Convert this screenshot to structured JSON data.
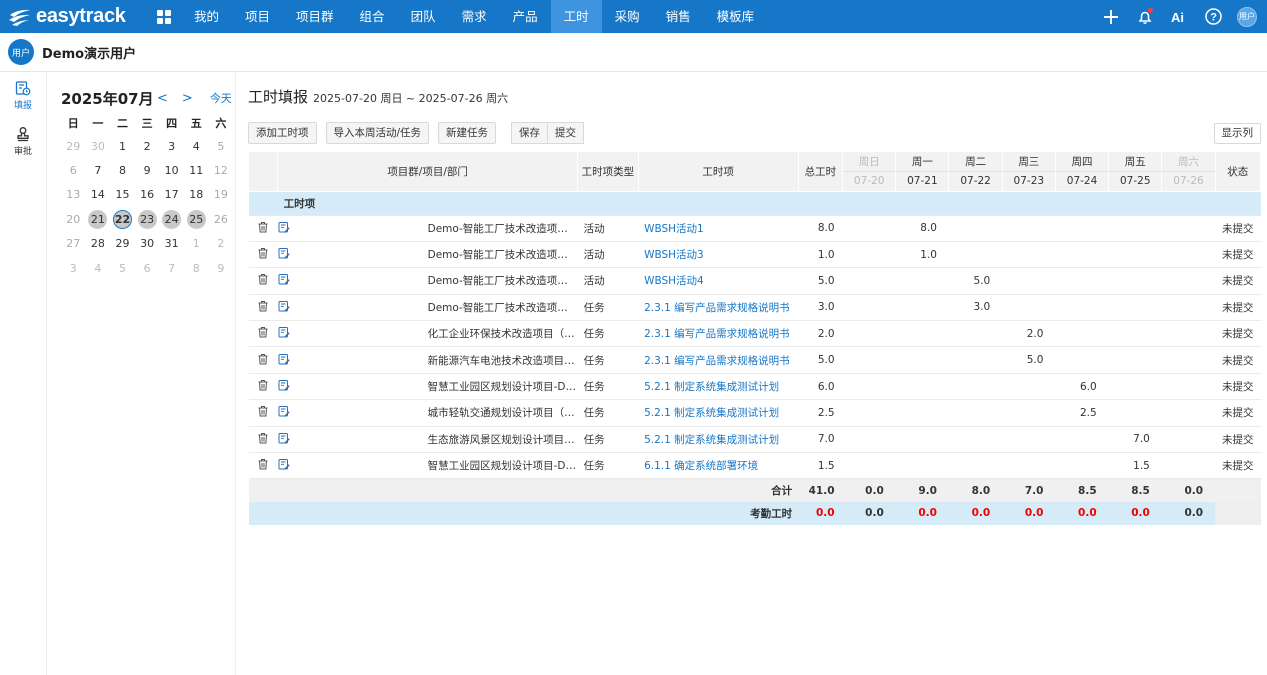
{
  "nav": {
    "logo_text": "easytrack",
    "items": [
      "我的",
      "项目",
      "项目群",
      "组合",
      "团队",
      "需求",
      "产品",
      "工时",
      "采购",
      "销售",
      "模板库"
    ],
    "active": "工时",
    "avatar_text": "用户"
  },
  "user": {
    "avatar_text": "用户",
    "name": "Demo演示用户"
  },
  "sidebar": {
    "items": [
      {
        "label": "填报"
      },
      {
        "label": "审批"
      }
    ]
  },
  "calendar": {
    "title": "2025年07月",
    "prev": "<",
    "next": ">",
    "today": "今天",
    "weekdays": [
      "日",
      "一",
      "二",
      "三",
      "四",
      "五",
      "六"
    ],
    "weeks": [
      [
        "29",
        "30",
        "1",
        "2",
        "3",
        "4",
        "5"
      ],
      [
        "6",
        "7",
        "8",
        "9",
        "10",
        "11",
        "12"
      ],
      [
        "13",
        "14",
        "15",
        "16",
        "17",
        "18",
        "19"
      ],
      [
        "20",
        "21",
        "22",
        "23",
        "24",
        "25",
        "26"
      ],
      [
        "27",
        "28",
        "29",
        "30",
        "31",
        "1",
        "2"
      ],
      [
        "3",
        "4",
        "5",
        "6",
        "7",
        "8",
        "9"
      ]
    ]
  },
  "main": {
    "title": "工时填报",
    "range": "2025-07-20 周日 ~ 2025-07-26 周六",
    "buttons": {
      "add": "添加工时项",
      "import": "导入本周活动/任务",
      "new_task": "新建任务",
      "save": "保存",
      "submit": "提交",
      "columns": "显示列"
    }
  },
  "table": {
    "headers": {
      "project": "项目群/项目/部门",
      "type": "工时项类型",
      "item": "工时项",
      "total": "总工时",
      "status": "状态"
    },
    "days": [
      {
        "name": "周日",
        "date": "07-20"
      },
      {
        "name": "周一",
        "date": "07-21"
      },
      {
        "name": "周二",
        "date": "07-22"
      },
      {
        "name": "周三",
        "date": "07-23"
      },
      {
        "name": "周四",
        "date": "07-24"
      },
      {
        "name": "周五",
        "date": "07-25"
      },
      {
        "name": "周六",
        "date": "07-26"
      }
    ],
    "group_label": "工时项",
    "rows": [
      {
        "project": "Demo-智能工厂技术改造项目（...",
        "type": "活动",
        "item": "WBSH活动1",
        "total": "8.0",
        "days": [
          "",
          "8.0",
          "",
          "",
          "",
          "",
          ""
        ],
        "status": "未提交"
      },
      {
        "project": "Demo-智能工厂技术改造项目（...",
        "type": "活动",
        "item": "WBSH活动3",
        "total": "1.0",
        "days": [
          "",
          "1.0",
          "",
          "",
          "",
          "",
          ""
        ],
        "status": "未提交"
      },
      {
        "project": "Demo-智能工厂技术改造项目（...",
        "type": "活动",
        "item": "WBSH活动4",
        "total": "5.0",
        "days": [
          "",
          "",
          "5.0",
          "",
          "",
          "",
          ""
        ],
        "status": "未提交"
      },
      {
        "project": "Demo-智能工厂技术改造项目（...",
        "type": "任务",
        "item": "2.3.1 编写产品需求规格说明书",
        "total": "3.0",
        "days": [
          "",
          "",
          "3.0",
          "",
          "",
          "",
          ""
        ],
        "status": "未提交"
      },
      {
        "project": "化工企业环保技术改造项目（2...",
        "type": "任务",
        "item": "2.3.1 编写产品需求规格说明书",
        "total": "2.0",
        "days": [
          "",
          "",
          "",
          "2.0",
          "",
          "",
          ""
        ],
        "status": "未提交"
      },
      {
        "project": "新能源汽车电池技术改造项目（...",
        "type": "任务",
        "item": "2.3.1 编写产品需求规格说明书",
        "total": "5.0",
        "days": [
          "",
          "",
          "",
          "5.0",
          "",
          "",
          ""
        ],
        "status": "未提交"
      },
      {
        "project": "智慧工业园区规划设计项目-De...",
        "type": "任务",
        "item": "5.2.1 制定系统集成测试计划",
        "total": "6.0",
        "days": [
          "",
          "",
          "",
          "",
          "6.0",
          "",
          ""
        ],
        "status": "未提交"
      },
      {
        "project": "城市轻轨交通规划设计项目（2...",
        "type": "任务",
        "item": "5.2.1 制定系统集成测试计划",
        "total": "2.5",
        "days": [
          "",
          "",
          "",
          "",
          "2.5",
          "",
          ""
        ],
        "status": "未提交"
      },
      {
        "project": "生态旅游风景区规划设计项目（...",
        "type": "任务",
        "item": "5.2.1 制定系统集成测试计划",
        "total": "7.0",
        "days": [
          "",
          "",
          "",
          "",
          "",
          "7.0",
          ""
        ],
        "status": "未提交"
      },
      {
        "project": "智慧工业园区规划设计项目-De...",
        "type": "任务",
        "item": "6.1.1 确定系统部署环境",
        "total": "1.5",
        "days": [
          "",
          "",
          "",
          "",
          "",
          "1.5",
          ""
        ],
        "status": "未提交"
      }
    ],
    "sum": {
      "label": "合计",
      "total": "41.0",
      "days": [
        "0.0",
        "9.0",
        "8.0",
        "7.0",
        "8.5",
        "8.5",
        "0.0"
      ]
    },
    "attendance": {
      "label": "考勤工时",
      "total": "0.0",
      "days": [
        "0.0",
        "0.0",
        "0.0",
        "0.0",
        "0.0",
        "0.0",
        "0.0"
      ]
    }
  }
}
